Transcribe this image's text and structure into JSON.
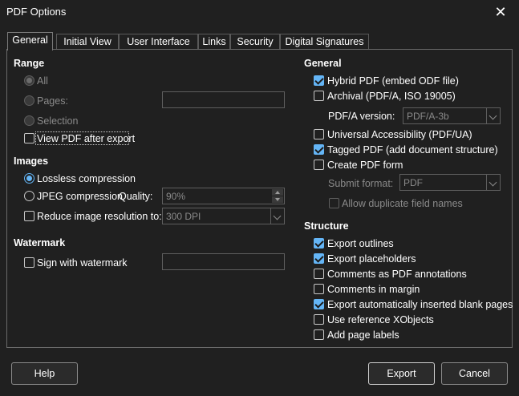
{
  "window": {
    "title": "PDF Options"
  },
  "tabs": [
    "General",
    "Initial View",
    "User Interface",
    "Links",
    "Security",
    "Digital Signatures"
  ],
  "range": {
    "heading": "Range",
    "all": "All",
    "pages": "Pages:",
    "selection": "Selection",
    "view_after_export": "View PDF after export"
  },
  "images": {
    "heading": "Images",
    "lossless": "Lossless compression",
    "jpeg": "JPEG compression",
    "quality_label": "Quality:",
    "quality_value": "90%",
    "reduce": "Reduce image resolution to:",
    "resolution_value": "300 DPI"
  },
  "watermark": {
    "heading": "Watermark",
    "sign": "Sign with watermark"
  },
  "general": {
    "heading": "General",
    "hybrid": "Hybrid PDF (embed ODF file)",
    "archival": "Archival (PDF/A, ISO 19005)",
    "pdfa_label": "PDF/A version:",
    "pdfa_value": "PDF/A-3b",
    "universal": "Universal Accessibility (PDF/UA)",
    "tagged": "Tagged PDF (add document structure)",
    "create_form": "Create PDF form",
    "submit_label": "Submit format:",
    "submit_value": "PDF",
    "allow_duplicates": "Allow duplicate field names"
  },
  "structure": {
    "heading": "Structure",
    "outlines": "Export outlines",
    "placeholders": "Export placeholders",
    "comments_annotations": "Comments as PDF annotations",
    "comments_margin": "Comments in margin",
    "blank_pages": "Export automatically inserted blank pages",
    "xobjects": "Use reference XObjects",
    "page_labels": "Add page labels"
  },
  "buttons": {
    "help": "Help",
    "export": "Export",
    "cancel": "Cancel"
  },
  "colors": {
    "accent": "#64b5f6",
    "background": "#202020"
  }
}
